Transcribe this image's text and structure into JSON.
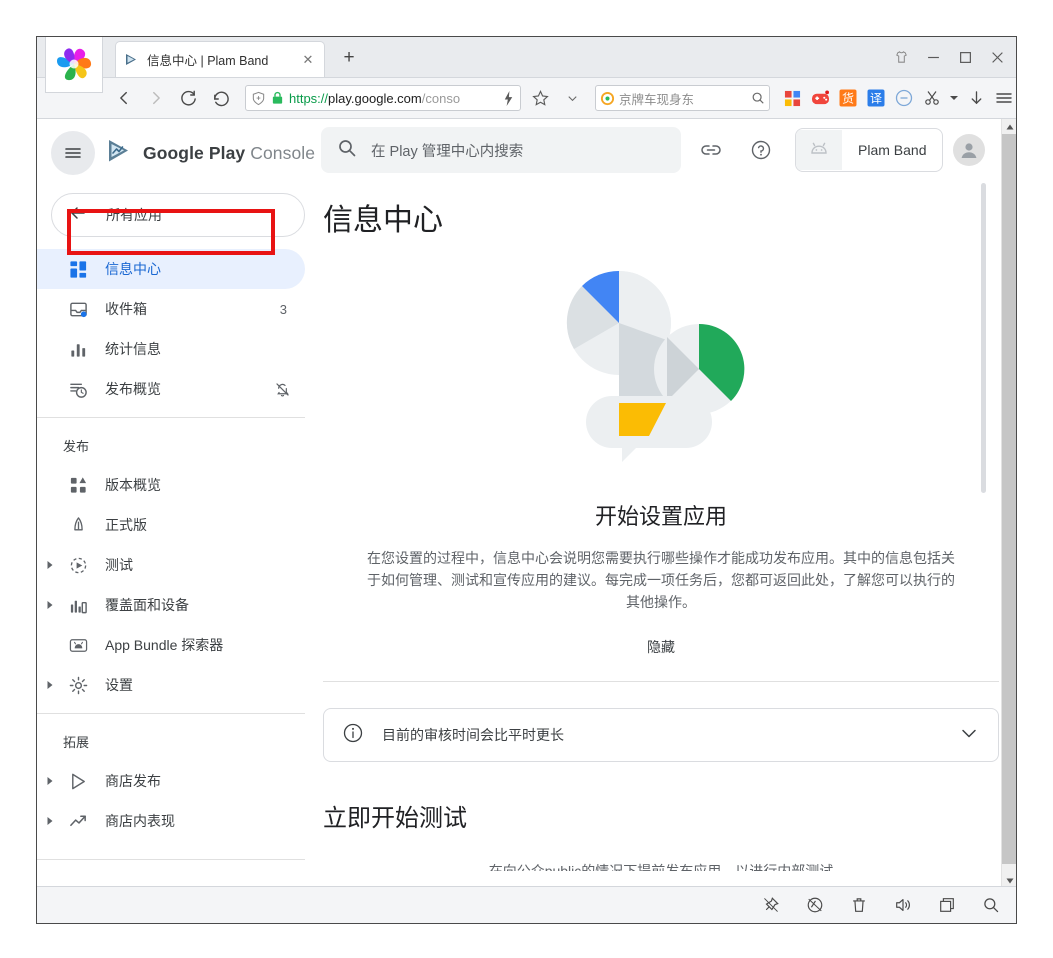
{
  "browser": {
    "tab": {
      "title": "信息中心 | Plam Band",
      "favicon_icon": "play-console-favicon",
      "close_icon": "close-icon"
    },
    "new_tab_label": "+",
    "window_controls": [
      {
        "name": "theme-button",
        "glyph": "theme-shirt-icon"
      },
      {
        "name": "minimize-button",
        "glyph": "minimize-icon"
      },
      {
        "name": "maximize-button",
        "glyph": "maximize-icon"
      },
      {
        "name": "close-window-button",
        "glyph": "close-icon"
      }
    ],
    "nav": {
      "back_icon": "back-arrow-icon",
      "forward_icon": "forward-arrow-icon",
      "reload_icon": "reload-icon",
      "undo_icon": "undo-icon"
    },
    "omnibox": {
      "shield_icon": "shield-icon",
      "lock_icon": "lock-icon",
      "url_scheme": "https://",
      "url_host": "play.google.com",
      "url_path": "/conso",
      "lightning_icon": "lightning-icon",
      "star_icon": "star-icon",
      "chevron_icon": "chevron-down-icon"
    },
    "searchbox": {
      "engine_icon": "search-engine-icon",
      "value": "京牌车现身东",
      "go_icon": "search-icon"
    },
    "extensions": [
      {
        "name": "apps-grid-extension",
        "label": "apps"
      },
      {
        "name": "game-extension",
        "label": "game"
      },
      {
        "name": "shopping-extension",
        "label": "货"
      },
      {
        "name": "translate-extension",
        "label": "译"
      },
      {
        "name": "blocker-extension",
        "label": "blocker"
      },
      {
        "name": "snip-extension",
        "label": "snip"
      },
      {
        "name": "downloads-extension",
        "label": "download"
      },
      {
        "name": "menu-extension",
        "label": "menu"
      }
    ]
  },
  "console": {
    "brand": {
      "logo_icon": "play-console-logo",
      "name_bold": "Google Play",
      "name_light": "Console",
      "hamburger_icon": "hamburger-menu-icon"
    },
    "all_apps": {
      "label": "所有应用",
      "icon": "back-arrow-icon"
    },
    "nav_primary": [
      {
        "label": "信息中心",
        "icon": "dashboard-icon",
        "badge": "",
        "active": true,
        "expandable": false,
        "trailing": ""
      },
      {
        "label": "收件箱",
        "icon": "inbox-icon",
        "badge": "3",
        "active": false,
        "expandable": false,
        "trailing": ""
      },
      {
        "label": "统计信息",
        "icon": "statistics-bar-icon",
        "badge": "",
        "active": false,
        "expandable": false,
        "trailing": ""
      },
      {
        "label": "发布概览",
        "icon": "publishing-overview-icon",
        "badge": "",
        "active": false,
        "expandable": false,
        "trailing": "notifications-off-icon"
      }
    ],
    "section_release": {
      "heading": "发布",
      "items": [
        {
          "label": "版本概览",
          "icon": "release-overview-icon",
          "expandable": false
        },
        {
          "label": "正式版",
          "icon": "production-icon",
          "expandable": false
        },
        {
          "label": "测试",
          "icon": "testing-icon",
          "expandable": true
        },
        {
          "label": "覆盖面和设备",
          "icon": "reach-devices-icon",
          "expandable": true
        },
        {
          "label": "App Bundle 探索器",
          "icon": "app-bundle-explorer-icon",
          "expandable": false
        },
        {
          "label": "设置",
          "icon": "gear-icon",
          "expandable": true
        }
      ]
    },
    "section_grow": {
      "heading": "拓展",
      "items": [
        {
          "label": "商店发布",
          "icon": "store-presence-icon",
          "expandable": true
        },
        {
          "label": "商店内表现",
          "icon": "store-performance-icon",
          "expandable": true
        }
      ]
    },
    "topbar": {
      "search_placeholder": "在 Play 管理中心内搜索",
      "search_icon": "search-icon",
      "link_icon": "link-icon",
      "help_icon": "help-circle-icon",
      "app_chip": {
        "name": "Plam Band",
        "icon": "android-app-icon"
      },
      "avatar_icon": "account-avatar-icon"
    },
    "main": {
      "page_title": "信息中心",
      "illustration_name": "dashboard-setup-illustration",
      "hero_heading": "开始设置应用",
      "hero_body": "在您设置的过程中，信息中心会说明您需要执行哪些操作才能成功发布应用。其中的信息包括关于如何管理、测试和宣传应用的建议。每完成一项任务后，您都可返回此处，了解您可以执行的其他操作。",
      "hide_label": "隐藏",
      "notice": {
        "icon": "info-circle-icon",
        "text": "目前的审核时间会比平时更长",
        "expand_icon": "chevron-down-icon"
      },
      "section_heading": "立即开始测试",
      "clipped_text": "在向公众public的情况下提前发布应用，以进行内部测试"
    }
  },
  "bottom_toolbar": [
    {
      "name": "pin-icon"
    },
    {
      "name": "ad-block-icon"
    },
    {
      "name": "trash-icon"
    },
    {
      "name": "speaker-icon"
    },
    {
      "name": "window-icon"
    },
    {
      "name": "search-icon"
    }
  ],
  "annotation": {
    "name": "red-highlight-box",
    "color": "#e81313",
    "targets": "所有应用"
  },
  "colors": {
    "accent_blue": "#1a73e8",
    "active_pill": "#e8f0fe",
    "text_primary": "#202124",
    "text_secondary": "#5f6368",
    "annotation_red": "#e81313"
  }
}
